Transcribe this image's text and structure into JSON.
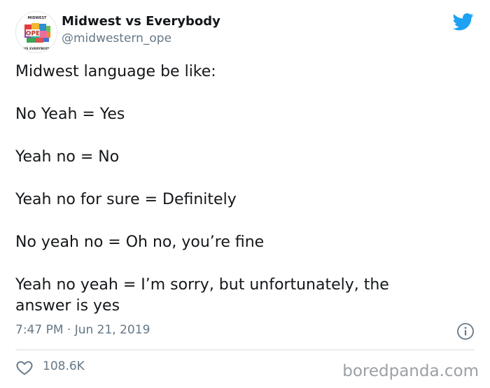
{
  "header": {
    "display_name": "Midwest vs Everybody",
    "handle": "@midwestern_ope",
    "avatar": {
      "badge_text": "OPE",
      "ring_text_top": "MIDWEST",
      "ring_text_bottom": "VS EVERYBODY"
    },
    "logo_icon": "twitter-bird-icon"
  },
  "tweet": {
    "lines": [
      "Midwest language be like:",
      "No Yeah = Yes",
      "Yeah no = No",
      "Yeah no for sure = Definitely",
      "No yeah no = Oh no, you’re fine",
      "Yeah no yeah = I’m sorry, but unfortunately, the",
      "answer is yes"
    ]
  },
  "footer": {
    "timestamp": "7:47 PM · Jun 21, 2019",
    "info_icon": "info-icon",
    "likes_count": "108.6K",
    "like_icon": "heart-icon"
  },
  "watermark": "boredpanda.com",
  "colors": {
    "twitter_blue": "#1da1f2",
    "secondary_text": "#657786",
    "primary_text": "#14171a"
  }
}
